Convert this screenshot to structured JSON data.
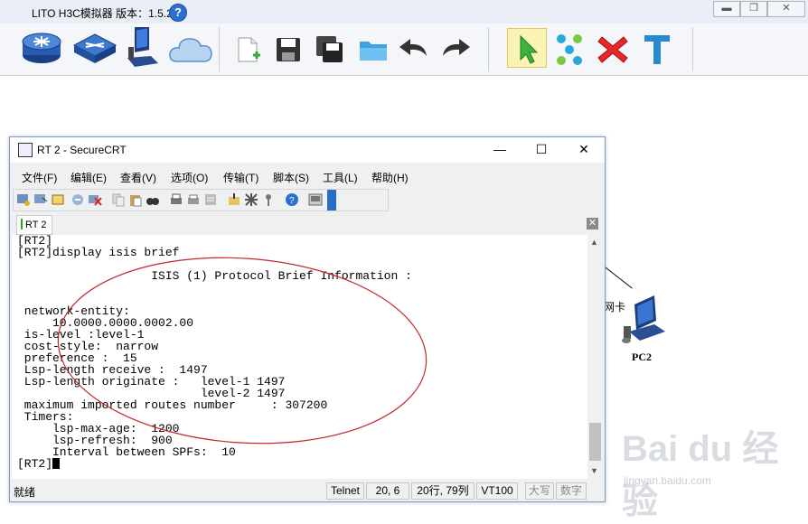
{
  "app": {
    "title": "LITO H3C模拟器 版本：1.5.2",
    "help_glyph": "?",
    "window_controls": [
      "▬",
      "❐",
      "✕"
    ]
  },
  "toolbar_icons": [
    "router-icon",
    "switch-icon",
    "pc-icon",
    "cloud-icon",
    "new-file-icon",
    "save-icon",
    "save-as-icon",
    "open-folder-icon",
    "undo-icon",
    "redo-icon",
    "select-pointer-icon",
    "connect-icon",
    "delete-icon",
    "text-tool-icon"
  ],
  "topology": {
    "pc_label": "PC2",
    "nic_label": "网卡"
  },
  "watermark": {
    "brand": "Bai du 经验",
    "url": "jingyan.baidu.com"
  },
  "securecrt": {
    "title": "RT 2 - SecureCRT",
    "controls": [
      "—",
      "☐",
      "✕"
    ],
    "menu": [
      "文件(F)",
      "编辑(E)",
      "查看(V)",
      "选项(O)",
      "传输(T)",
      "脚本(S)",
      "工具(L)",
      "帮助(H)"
    ],
    "tab_label": "RT 2",
    "tab_close": "✕",
    "terminal_lines": [
      "[RT2]",
      "[RT2]display isis brief",
      "                   ISIS (1) Protocol Brief Information :",
      "",
      "",
      " network-entity:",
      "     10.0000.0000.0002.00",
      " is-level :level-1",
      " cost-style:  narrow",
      " preference :  15",
      " Lsp-length receive :  1497",
      " Lsp-length originate :   level-1 1497",
      "                          level-2 1497",
      " maximum imported routes number     : 307200",
      " Timers:",
      "     lsp-max-age:  1200",
      "     lsp-refresh:  900",
      "     Interval between SPFs:  10",
      "[RT2]"
    ],
    "status": {
      "ready": "就绪",
      "protocol": "Telnet",
      "cursor_pos": "20,   6",
      "rows_cols": "20行, 79列",
      "emulation": "VT100",
      "caps": "大写",
      "num": "数字"
    }
  }
}
